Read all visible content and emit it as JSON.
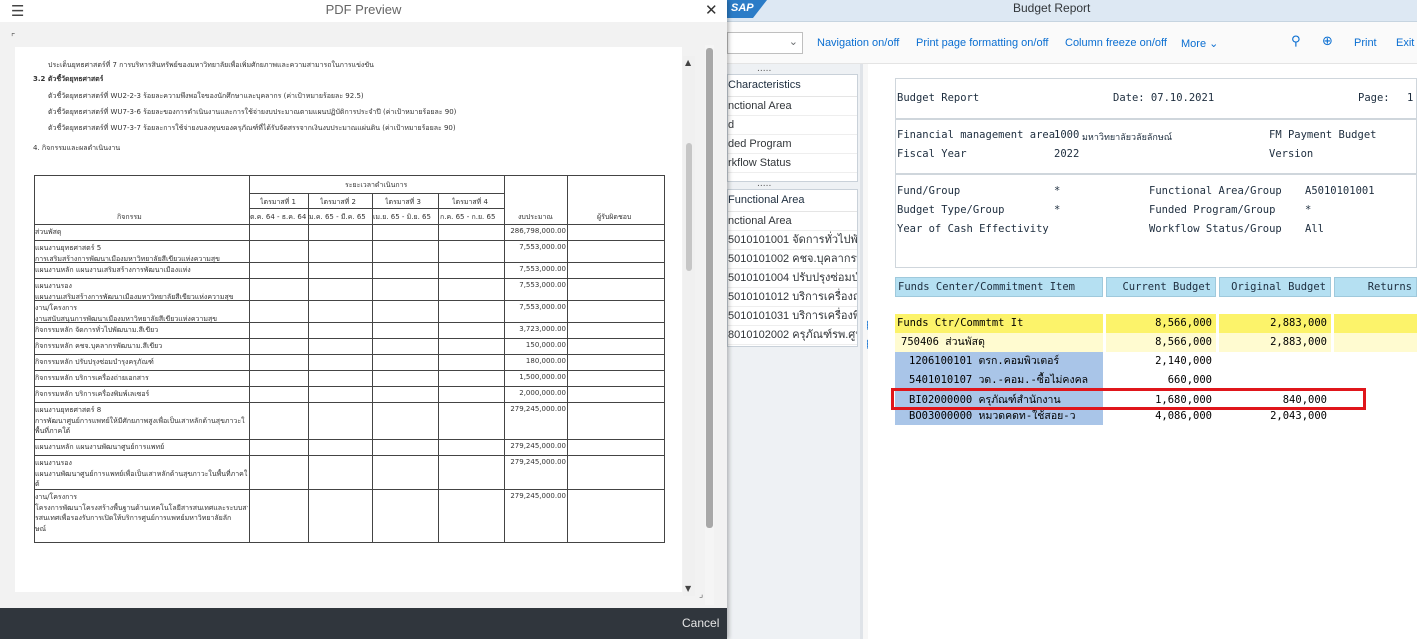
{
  "sap": {
    "window_title": "Budget Report",
    "logo": "SAP",
    "toolbar": [
      "Navigation on/off",
      "Print page formatting on/off",
      "Column freeze on/off",
      "More",
      "Print",
      "Exit"
    ],
    "icons": [
      "search-icon",
      "zoom-in-icon"
    ],
    "nav_char_header": "Characteristics",
    "nav_char_rows": [
      "nctional Area",
      "d",
      "ded Program",
      "rkflow Status"
    ],
    "nav_fa_header": "Functional Area",
    "nav_fa_sub": "nctional Area",
    "nav_fa_rows": [
      "5010101001 จัดการทั่วไปพัฒน",
      "5010101002 คชจ.บุคลากรพัฒ",
      "5010101004 ปรับปรุงซ่อมบำรุ",
      "5010101012 บริการเครื่องถ่ายเ",
      "5010101031 บริการเครื่องพิมพ์",
      "8010102002 ครุภัณฑ์รพ.ศูนย์แ"
    ]
  },
  "report": {
    "title": "Budget Report",
    "date_label": "Date: 07.10.2021",
    "page_label": "Page:",
    "page_value": "1",
    "fm_area_label": "Financial management area",
    "fm_area_code": "1000",
    "fm_area_name": "มหาวิทยาลัยวลัยลักษณ์",
    "fm_payment_budget": "FM Payment Budget",
    "fiscal_year_label": "Fiscal Year",
    "fiscal_year": "2022",
    "version_label": "Version",
    "fund_group_label": "Fund/Group",
    "fund_group": "*",
    "budget_type_label": "Budget Type/Group",
    "budget_type": "*",
    "cash_eff_label": "Year of Cash Effectivity",
    "func_area_label": "Functional Area/Group",
    "func_area": "A5010101001",
    "funded_prog_label": "Funded Program/Group",
    "funded_prog": "*",
    "wf_status_label": "Workflow Status/Group",
    "wf_status": "All",
    "columns": [
      "Funds Center/Commitment Item",
      "Current Budget",
      "Original Budget",
      "Returns"
    ],
    "rows": [
      {
        "item": "Funds Ctr/Commtmt It",
        "current": "8,566,000",
        "original": "2,883,000"
      },
      {
        "item": "750406 ส่วนพัสดุ",
        "current": "8,566,000",
        "original": "2,883,000"
      },
      {
        "item": "1206100101 ตรก.คอมพิวเตอร์",
        "current": "2,140,000",
        "original": ""
      },
      {
        "item": "5401010107 วด.-คอม.-ซื้อไม่คงคล",
        "current": "660,000",
        "original": ""
      },
      {
        "item": "BI02000000 ครุภัณฑ์สำนักงาน",
        "current": "1,680,000",
        "original": "840,000"
      },
      {
        "item": "BO03000000 หมวดคดท-ใช้สอย-ว",
        "current": "4,086,000",
        "original": "2,043,000"
      }
    ],
    "highlight_color": "#e0161b"
  },
  "pdf": {
    "title": "PDF Preview",
    "cancel": "Cancel",
    "intro_lines": [
      "ประเด็นยุทธศาสตร์ที่ 7 การบริหารสินทรัพย์ของมหาวิทยาลัยเพื่อเพิ่มศักยภาพและความสามารถในการแข่งขัน",
      "3.2 ตัวชี้วัดยุทธศาสตร์",
      "ตัวชี้วัดยุทธศาสตร์ที่ WU2-2-3 ร้อยละความพึงพอใจของนักศึกษาและบุคลากร (ค่าเป้าหมายร้อยละ 92.5)",
      "ตัวชี้วัดยุทธศาสตร์ที่ WU7-3-6 ร้อยละของการดำเนินงานและการใช้จ่ายงบประมาณตามแผนปฏิบัติการประจำปี (ค่าเป้าหมายร้อยละ 90)",
      "ตัวชี้วัดยุทธศาสตร์ที่ WU7-3-7 ร้อยละการใช้จ่ายงบลงทุนของครุภัณฑ์ที่ได้รับจัดสรรจากเงินงบประมาณแผ่นดิน (ค่าเป้าหมายร้อยละ 90)",
      "4. กิจกรรมและผลดำเนินงาน"
    ],
    "table_header": {
      "period": "ระยะเวลาดำเนินการ",
      "activity": "กิจกรรม",
      "quarters": [
        "ไตรมาสที่ 1",
        "ไตรมาสที่ 2",
        "ไตรมาสที่ 3",
        "ไตรมาสที่ 4"
      ],
      "quarter_dates": [
        "ต.ค. 64 - ธ.ค. 64",
        "ม.ค. 65 - มี.ค. 65",
        "เม.ย. 65 - มิ.ย. 65",
        "ก.ค. 65 - ก.ย. 65"
      ],
      "budget": "งบประมาณ",
      "owner": "ผู้รับผิดชอบ"
    },
    "table_rows": [
      {
        "lines": [
          "ส่วนพัสดุ"
        ],
        "amount": "286,798,000.00"
      },
      {
        "lines": [
          "แผนงานยุทธศาสตร์ 5",
          "การเสริมสร้างการพัฒนาเมืองมหาวิทยาลัยสีเขียวแห่งความสุข"
        ],
        "amount": "7,553,000.00"
      },
      {
        "lines": [
          "แผนงานหลัก  แผนงานเสริมสร้างการพัฒนาเมืองแห่ง"
        ],
        "amount": "7,553,000.00"
      },
      {
        "lines": [
          "แผนงานรอง",
          "แผนงานเสริมสร้างการพัฒนาเมืองมหาวิทยาลัยสีเขียวแห่งความสุข"
        ],
        "amount": "7,553,000.00"
      },
      {
        "lines": [
          "งาน/โครงการ",
          "งานสนับสนุนการพัฒนาเมืองมหาวิทยาลัยสีเขียวแห่งความสุข"
        ],
        "amount": "7,553,000.00"
      },
      {
        "lines": [
          "กิจกรรมหลัก จัดการทั่วไปพัฒนาม.สีเขียว"
        ],
        "amount": "3,723,000.00"
      },
      {
        "lines": [
          "กิจกรรมหลัก คชจ.บุคลากรพัฒนาม.สีเขียว"
        ],
        "amount": "150,000.00"
      },
      {
        "lines": [
          "กิจกรรมหลัก ปรับปรุงซ่อมบำรุงครุภัณฑ์"
        ],
        "amount": "180,000.00"
      },
      {
        "lines": [
          "กิจกรรมหลัก บริการเครื่องถ่ายเอกสาร"
        ],
        "amount": "1,500,000.00"
      },
      {
        "lines": [
          "กิจกรรมหลัก บริการเครื่องพิมพ์เลเซอร์"
        ],
        "amount": "2,000,000.00"
      },
      {
        "lines": [
          "แผนงานยุทธศาสตร์ 8",
          "การพัฒนาศูนย์การแพทย์ให้มีศักยภาพสูงเพื่อเป็นเสาหลักด้านสุขภาวะใ",
          "พื้นที่ภาคใต้"
        ],
        "amount": "279,245,000.00"
      },
      {
        "lines": [
          "แผนงานหลัก  แผนงานพัฒนาศูนย์การแพทย์"
        ],
        "amount": "279,245,000.00"
      },
      {
        "lines": [
          "แผนงานรอง",
          "แผนงานพัฒนาศูนย์การแพทย์เพื่อเป็นเสาหลักด้านสุขภาวะในพื้นที่ภาคใ",
          "ต้"
        ],
        "amount": "279,245,000.00"
      },
      {
        "lines": [
          "งาน/โครงการ",
          "โครงการพัฒนาโครงสร้างพื้นฐานด้านเทคโนโลยีสารสนเทศและระบบสา",
          "รสนเทศเพื่อรองรับการเปิดให้บริการศูนย์การแพทย์มหาวิทยาลัยลัก",
          "ษณ์"
        ],
        "amount": "279,245,000.00"
      }
    ]
  }
}
